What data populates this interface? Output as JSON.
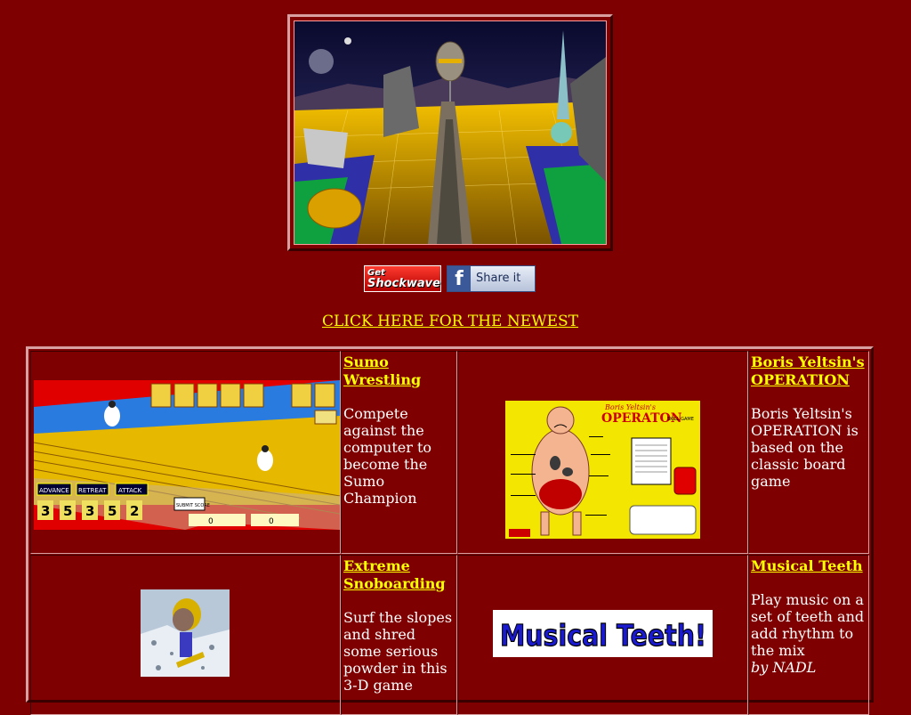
{
  "buttons": {
    "shockwave_line1": "Get",
    "shockwave_line2": "Shockwave",
    "share_label": "Share it",
    "fb_glyph": "f"
  },
  "newest_link": "CLICK HERE FOR THE NEWEST",
  "games": [
    {
      "title": "Sumo Wrestling",
      "description": "Compete against the computer to become the Sumo Champion",
      "author": "",
      "thumb": {
        "buttons": [
          "ADVANCE",
          "RETREAT",
          "ATTACK"
        ],
        "cards": [
          "3",
          "5",
          "3",
          "5",
          "2"
        ],
        "submit": "SUBMIT SCORE",
        "scores": [
          "0",
          "0"
        ]
      }
    },
    {
      "title": "Boris Yeltsin's OPERATION",
      "description": "Boris Yeltsin's OPERATION is based on the classic board game",
      "author": "",
      "thumb": {
        "heading_small": "Boris Yeltsin's",
        "heading_big": "OPERATON",
        "sub": "SKILL GAME"
      }
    },
    {
      "title": "Extreme Snoboarding",
      "description": "Surf the slopes and shred some serious powder in this 3-D game",
      "author": ""
    },
    {
      "title": "Musical Teeth",
      "description": "Play music on a set of teeth and add rhythm to the mix",
      "author": "by NADL",
      "thumb": {
        "label": "Musical Teeth!"
      }
    }
  ]
}
